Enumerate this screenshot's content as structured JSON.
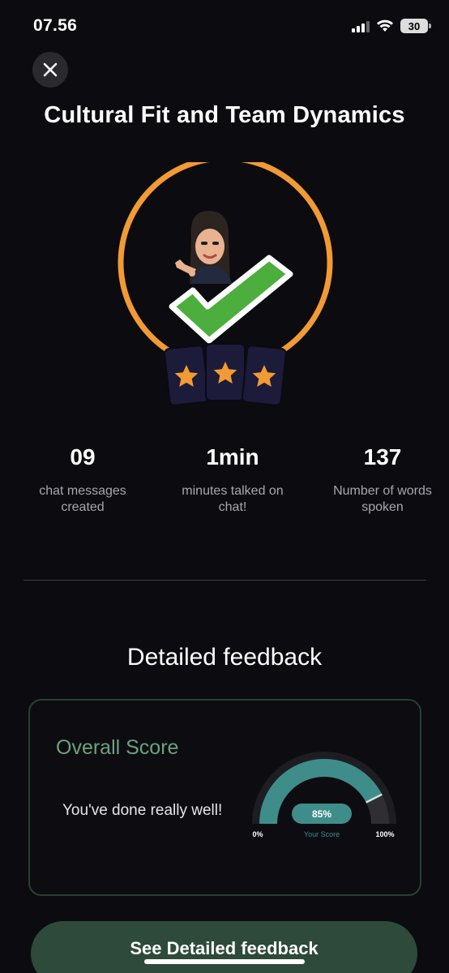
{
  "status_bar": {
    "time": "07.56",
    "battery": "30"
  },
  "header": {
    "close_icon": "close-icon",
    "title": "Cultural Fit and Team Dynamics"
  },
  "hero": {
    "stars_count": 3,
    "accent_color": "#f29a33",
    "check_color": "#4cae3d",
    "card_color": "#1c1b3a"
  },
  "stats": [
    {
      "value": "09",
      "label": "chat messages created"
    },
    {
      "value": "1min",
      "label": "minutes talked on chat!"
    },
    {
      "value": "137",
      "label": "Number of words spoken"
    }
  ],
  "feedback": {
    "section_title": "Detailed feedback",
    "card_title": "Overall Score",
    "message": "You've done really well!",
    "gauge": {
      "score_text": "85%",
      "score_value": 0.85,
      "caption": "Your Score",
      "min_label": "0%",
      "max_label": "100%",
      "fill_color": "#3f8d8a"
    }
  },
  "cta": {
    "label": "See Detailed feedback"
  }
}
